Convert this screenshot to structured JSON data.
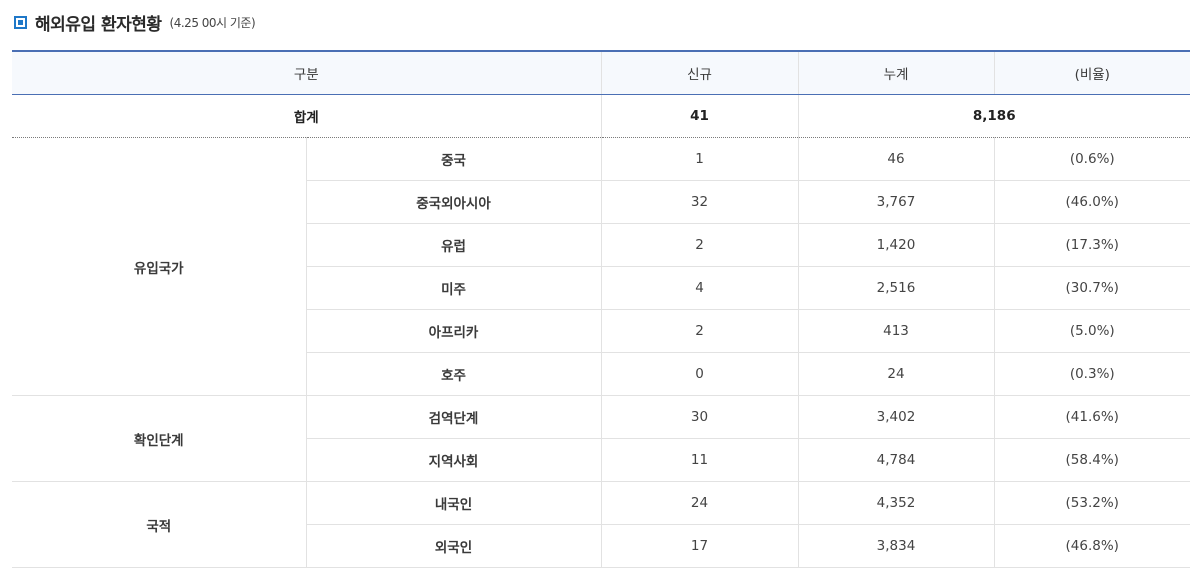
{
  "header": {
    "title": "해외유입 환자현황",
    "subtitle": "(4.25 00시 기준)"
  },
  "table": {
    "columns": [
      "구분",
      "신규",
      "누계",
      "(비율)"
    ],
    "total": {
      "label": "합계",
      "new": "41",
      "cumulative": "8,186"
    },
    "groups": [
      {
        "label": "유입국가",
        "rows": [
          {
            "label": "중국",
            "new": "1",
            "cumulative": "46",
            "ratio": "(0.6%)"
          },
          {
            "label": "중국외아시아",
            "new": "32",
            "cumulative": "3,767",
            "ratio": "(46.0%)"
          },
          {
            "label": "유럽",
            "new": "2",
            "cumulative": "1,420",
            "ratio": "(17.3%)"
          },
          {
            "label": "미주",
            "new": "4",
            "cumulative": "2,516",
            "ratio": "(30.7%)"
          },
          {
            "label": "아프리카",
            "new": "2",
            "cumulative": "413",
            "ratio": "(5.0%)"
          },
          {
            "label": "호주",
            "new": "0",
            "cumulative": "24",
            "ratio": "(0.3%)"
          }
        ]
      },
      {
        "label": "확인단계",
        "rows": [
          {
            "label": "검역단계",
            "new": "30",
            "cumulative": "3,402",
            "ratio": "(41.6%)"
          },
          {
            "label": "지역사회",
            "new": "11",
            "cumulative": "4,784",
            "ratio": "(58.4%)"
          }
        ]
      },
      {
        "label": "국적",
        "rows": [
          {
            "label": "내국인",
            "new": "24",
            "cumulative": "4,352",
            "ratio": "(53.2%)"
          },
          {
            "label": "외국인",
            "new": "17",
            "cumulative": "3,834",
            "ratio": "(46.8%)"
          }
        ]
      }
    ]
  },
  "colors": {
    "accent": "#1f78c8",
    "header_border": "#4a6fb4",
    "header_bg": "#f6f9fd",
    "grid": "#e2e2e2"
  },
  "icons": {
    "title_icon": "square-bullet-icon"
  }
}
